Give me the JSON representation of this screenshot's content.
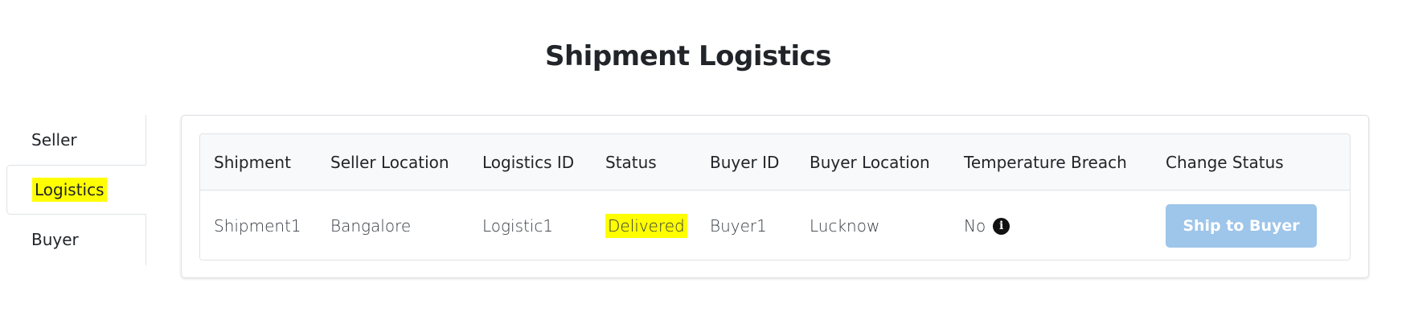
{
  "page": {
    "title": "Shipment Logistics"
  },
  "sidebar": {
    "items": [
      {
        "label": "Seller"
      },
      {
        "label": "Logistics"
      },
      {
        "label": "Buyer"
      }
    ],
    "active": "Logistics",
    "highlight_color": "#ffff00"
  },
  "table": {
    "headers": [
      "Shipment",
      "Seller Location",
      "Logistics ID",
      "Status",
      "Buyer ID",
      "Buyer Location",
      "Temperature Breach",
      "Change Status"
    ],
    "rows": [
      {
        "shipment": "Shipment1",
        "seller_location": "Bangalore",
        "logistics_id": "Logistic1",
        "status": "Delivered",
        "buyer_id": "Buyer1",
        "buyer_location": "Lucknow",
        "temperature_breach": "No",
        "temperature_icon": "info-icon",
        "action_label": "Ship to Buyer",
        "action_disabled": true
      }
    ]
  },
  "colors": {
    "button_disabled": "#9ec5ea",
    "highlight": "#ffff00",
    "header_bg": "#f8f9fa"
  }
}
